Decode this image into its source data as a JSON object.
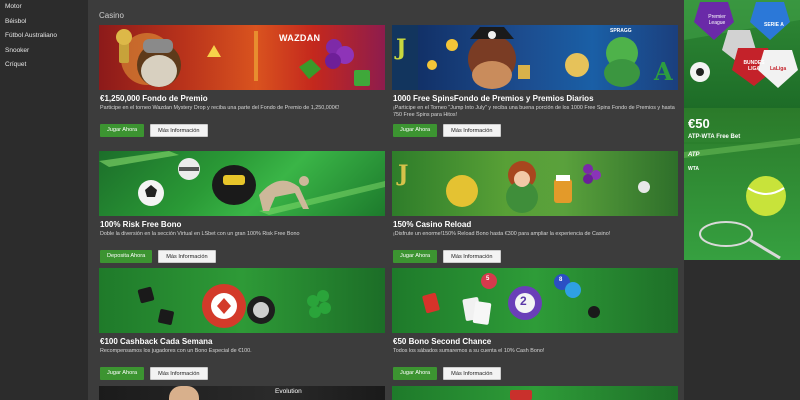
{
  "sidebar": {
    "items": [
      {
        "label": "Motor"
      },
      {
        "label": "Béisbol"
      },
      {
        "label": "Fútbol Australiano"
      },
      {
        "label": "Snooker"
      },
      {
        "label": "Críquet"
      }
    ]
  },
  "main": {
    "section_title": "Casino",
    "cards": [
      {
        "title": "€1,250,000 Fondo de Premio",
        "description": "Participe en el torneo Wazdan Mystery Drop y reciba una parte del Fondo de Premio de 1,250,000€!",
        "primary_label": "Jugar Ahora",
        "secondary_label": "Más Información",
        "banner_text": "WAZDAN"
      },
      {
        "title": "1000 Free SpinsFondo de Premios y Premios Diarios",
        "description": "¡Participe en el Torneo \"Jump Into July\" y reciba una buena porción de los 1000 Free Spins Fondo de Premios y hasta 750 Free Spins para Hitos!",
        "primary_label": "Jugar Ahora",
        "secondary_label": "Más Información",
        "banner_text": "SPRAGG"
      },
      {
        "title": "100% Risk Free Bono",
        "description": "Doble la diversión en la sección Virtual en LSbet con un gran 100% Risk Free Bono",
        "primary_label": "Deposita Ahora",
        "secondary_label": "Más Información"
      },
      {
        "title": "150% Casino Reload",
        "description": "¡Disfrute un enorme!150% Reload Bono hasta €300 para ampliar la experiencia de Casino!",
        "primary_label": "Jugar Ahora",
        "secondary_label": "Más Información"
      },
      {
        "title": "€100 Cashback Cada Semana",
        "description": "Recompensamos los jugadores con un Bono Especial de €100.",
        "primary_label": "Jugar Ahora",
        "secondary_label": "Más Información"
      },
      {
        "title": "€50 Bono Second Chance",
        "description": "Todos los sábados sumaremos a su cuenta el 10% Cash Bono!",
        "primary_label": "Jugar Ahora",
        "secondary_label": "Más Información",
        "ball_numbers": [
          "5",
          "2",
          "8"
        ]
      },
      {
        "banner_text": "Evolution"
      }
    ]
  },
  "right_column": {
    "leagues": [
      "Premier League",
      "SERIE A",
      "BUNDES LIGA",
      "LaLiga"
    ],
    "promo_amount": "€50",
    "promo_label": "ATP-WTA Free Bet",
    "logos": [
      "ATP",
      "WTA"
    ]
  },
  "colors": {
    "primary_button": "#3c9431",
    "background": "#3c3c3c",
    "sidebar": "#2c2c2c"
  }
}
